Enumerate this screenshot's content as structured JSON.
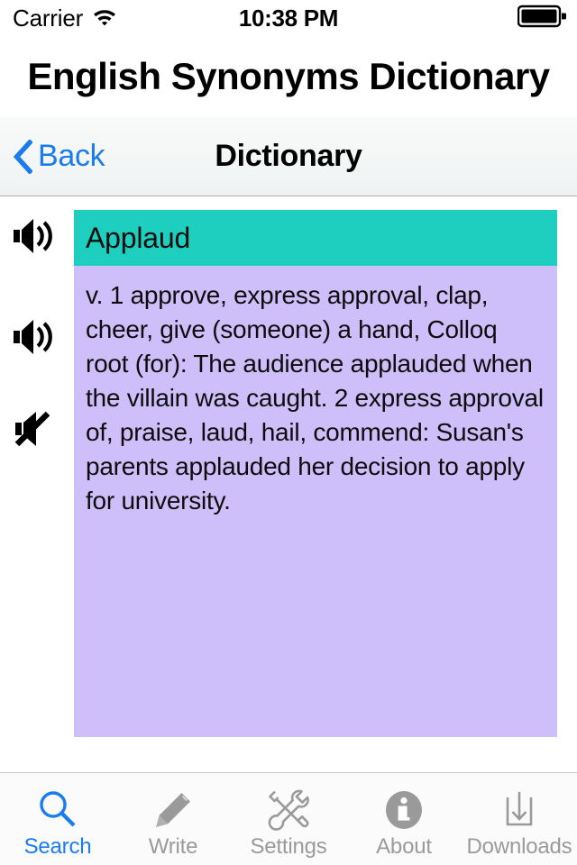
{
  "status_bar": {
    "carrier": "Carrier",
    "wifi_icon": "wifi-icon",
    "time": "10:38 PM",
    "battery_icon": "battery-full-icon"
  },
  "app": {
    "title": "English Synonyms Dictionary"
  },
  "nav_bar": {
    "back_label": "Back",
    "back_icon": "chevron-left-icon",
    "title": "Dictionary",
    "accent_color": "#1a7ced"
  },
  "content": {
    "audio_controls": [
      {
        "icon": "speaker-play-icon",
        "name": "play-word-button"
      },
      {
        "icon": "speaker-play-icon",
        "name": "play-definition-button"
      },
      {
        "icon": "speaker-mute-icon",
        "name": "stop-audio-button"
      }
    ],
    "entry": {
      "word": "Applaud",
      "word_bg_color": "#1ecfc0",
      "definition_bg_color": "#cebef9",
      "definition": "v. 1 approve, express approval, clap, cheer, give (someone) a hand, Colloq root (for): The audience applauded when the villain was caught. 2 express approval of, praise, laud, hail, commend: Susan's parents applauded her decision to apply for university."
    }
  },
  "tab_bar": {
    "active_index": 0,
    "active_color": "#1a7ced",
    "inactive_color": "#9a9a9a",
    "tabs": [
      {
        "label": "Search",
        "icon": "magnifier-icon"
      },
      {
        "label": "Write",
        "icon": "pencil-icon"
      },
      {
        "label": "Settings",
        "icon": "wrench-screwdriver-icon"
      },
      {
        "label": "About",
        "icon": "info-circle-icon"
      },
      {
        "label": "Downloads",
        "icon": "download-tray-icon"
      }
    ]
  }
}
